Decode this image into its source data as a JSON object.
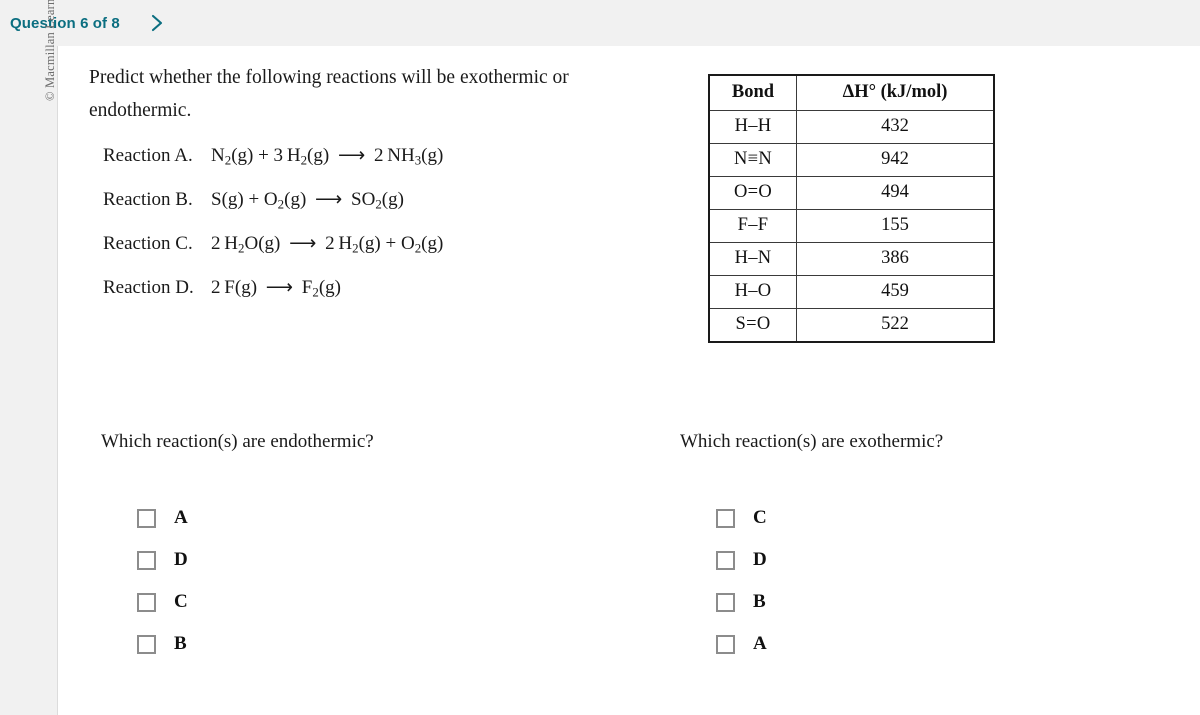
{
  "header": {
    "question_counter": "Question 6 of 8",
    "next_icon": "chevron-right-icon"
  },
  "sidebar": {
    "copyright": "© Macmillan Learning"
  },
  "question": {
    "prompt": "Predict whether the following reactions will be exothermic or endothermic.",
    "reactions": [
      {
        "name": "Reaction A.",
        "equation_plain": "N2(g) + 3 H2(g) ⟶ 2 NH3(g)",
        "equation_html": "N<sub>2</sub>(g) + 3&#8239;H<sub>2</sub>(g) <span class=\"arrow\">⟶</span> 2&#8239;NH<sub>3</sub>(g)"
      },
      {
        "name": "Reaction B.",
        "equation_plain": "S(g) + O2(g) ⟶ SO2(g)",
        "equation_html": "S(g) + O<sub>2</sub>(g) <span class=\"arrow\">⟶</span> SO<sub>2</sub>(g)"
      },
      {
        "name": "Reaction C.",
        "equation_plain": "2 H2O(g) ⟶ 2 H2(g) + O2(g)",
        "equation_html": "2&#8239;H<sub>2</sub>O(g) <span class=\"arrow\">⟶</span> 2&#8239;H<sub>2</sub>(g) + O<sub>2</sub>(g)"
      },
      {
        "name": "Reaction D.",
        "equation_plain": "2 F(g) ⟶ F2(g)",
        "equation_html": "2&#8239;F(g) <span class=\"arrow\">⟶</span> F<sub>2</sub>(g)"
      }
    ]
  },
  "bond_table": {
    "headers": [
      "Bond",
      "ΔH° (kJ/mol)"
    ],
    "rows": [
      {
        "bond": "H–H",
        "value": "432"
      },
      {
        "bond": "N≡N",
        "value": "942"
      },
      {
        "bond": "O=O",
        "value": "494"
      },
      {
        "bond": "F–F",
        "value": "155"
      },
      {
        "bond": "H–N",
        "value": "386"
      },
      {
        "bond": "H–O",
        "value": "459"
      },
      {
        "bond": "S=O",
        "value": "522"
      }
    ]
  },
  "answers": {
    "endothermic": {
      "question": "Which reaction(s) are endothermic?",
      "options": [
        {
          "label": "A",
          "checked": false
        },
        {
          "label": "D",
          "checked": false
        },
        {
          "label": "C",
          "checked": false
        },
        {
          "label": "B",
          "checked": false
        }
      ]
    },
    "exothermic": {
      "question": "Which reaction(s) are exothermic?",
      "options": [
        {
          "label": "C",
          "checked": false
        },
        {
          "label": "D",
          "checked": false
        },
        {
          "label": "B",
          "checked": false
        },
        {
          "label": "A",
          "checked": false
        }
      ]
    }
  },
  "colors": {
    "accent": "#0b6e80",
    "page_background": "#f1f1f1",
    "card_background": "#ffffff",
    "checkbox_border": "#8c8c8c",
    "table_border": "#1a1a1a"
  }
}
